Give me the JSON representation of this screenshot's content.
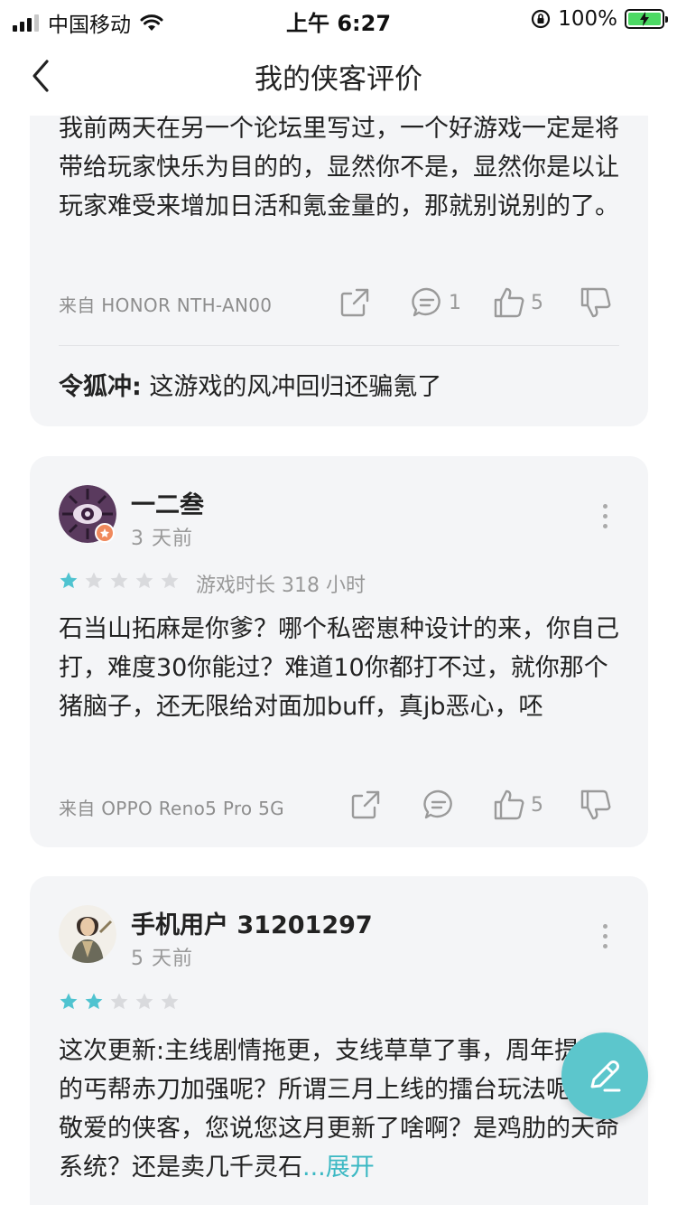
{
  "status_bar": {
    "carrier": "中国移动",
    "time": "上午 6:27",
    "battery": "100%"
  },
  "nav": {
    "title": "我的侠客评价"
  },
  "reviews": [
    {
      "text": "我前两天在另一个论坛里写过，一个好游戏一定是将带给玩家快乐为目的的，显然你不是，显然你是以让玩家难受来增加日活和氪金量的，那就别说别的了。",
      "device": "来自 HONOR NTH-AN00",
      "comments": "1",
      "likes": "5",
      "reply_user": "令狐冲:",
      "reply_text": " 这游戏的风冲回归还骗氪了"
    },
    {
      "username": "一二叁",
      "time_ago": "3 天前",
      "rating": 1,
      "playtime": "游戏时长 318 小时",
      "text": "石当山拓麻是你爹？哪个私密崽种设计的来，你自己打，难度30你能过？难道10你都打不过，就你那个猪脑子，还无限给对面加buff，真jb恶心，呸",
      "device": "来自 OPPO Reno5 Pro 5G",
      "likes": "5"
    },
    {
      "username": "手机用户 31201297",
      "time_ago": "5 天前",
      "rating": 2,
      "text": "这次更新:主线剧情拖更，支线草草了事，周年提到的丐帮赤刀加强呢？所谓三月上线的擂台玩法呢？我敬爱的侠客，您说您这月更新了啥啊？是鸡肋的天命系统？还是卖几千灵石",
      "expand": "...展开"
    }
  ],
  "colors": {
    "accent": "#5cc6cc",
    "star_on": "#4fc3d0",
    "star_off": "#d9dadd",
    "card_bg": "#f4f5f7"
  }
}
